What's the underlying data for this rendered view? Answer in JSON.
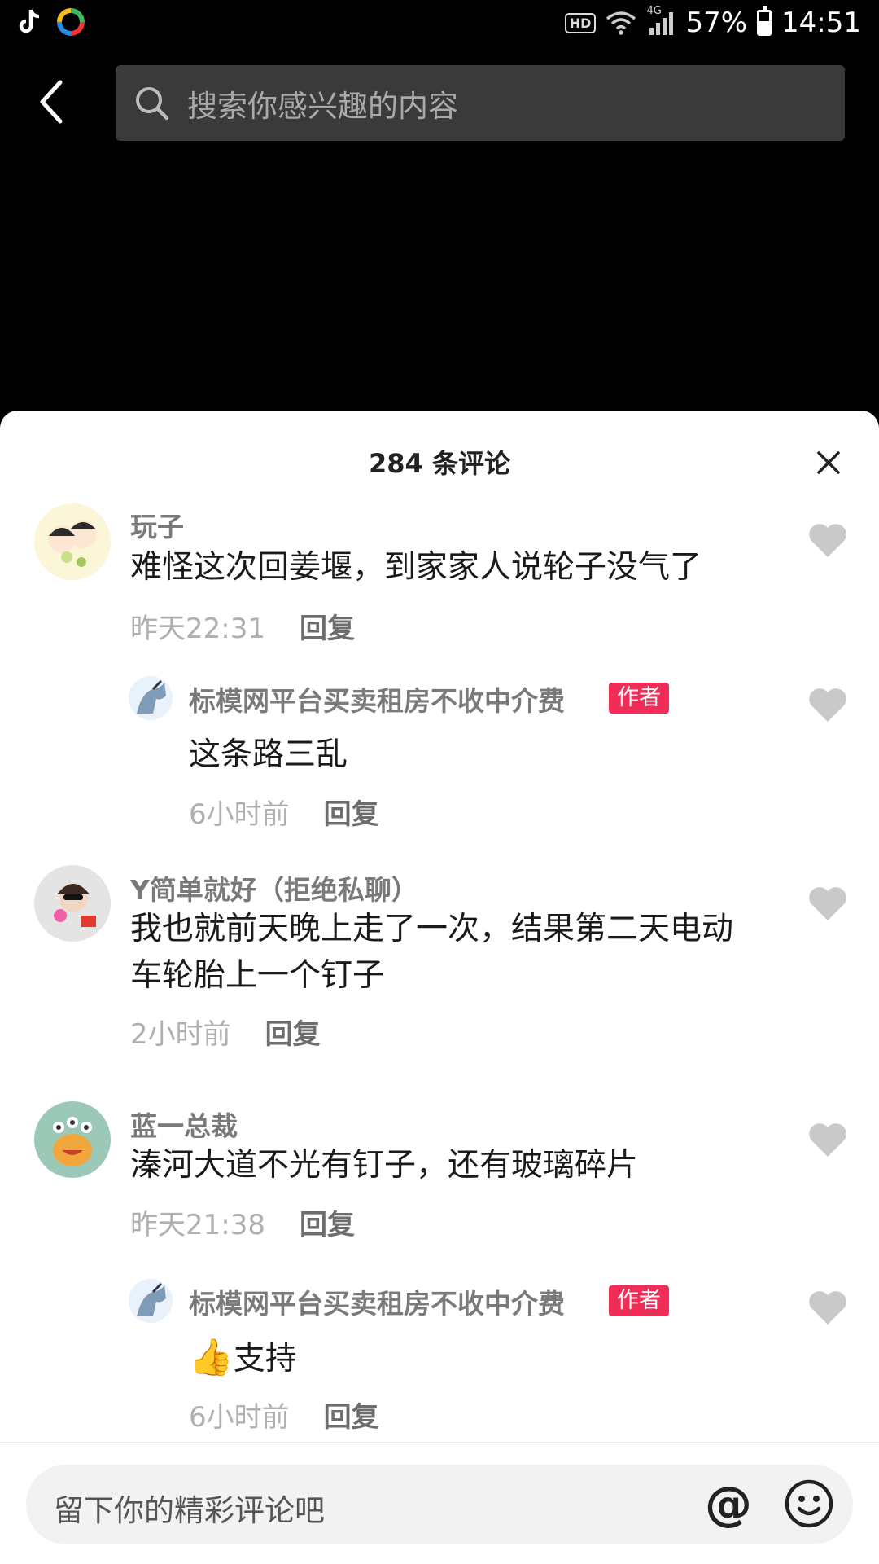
{
  "status_bar": {
    "hd": "HD",
    "network": "4G",
    "battery": "57%",
    "battery_level": 0.57,
    "time": "14:51"
  },
  "search": {
    "placeholder": "搜索你感兴趣的内容"
  },
  "comments_header": {
    "title": "284 条评论"
  },
  "comments": [
    {
      "username": "玩子",
      "text": "难怪这次回姜堰，到家家人说轮子没气了",
      "time": "昨天22:31",
      "reply": "回复",
      "badge": ""
    },
    {
      "username": "标模网平台买卖租房不收中介费",
      "text": "这条路三乱",
      "time": "6小时前",
      "reply": "回复",
      "badge": "作者"
    },
    {
      "username": "Y简单就好（拒绝私聊）",
      "text_line1": "我也就前天晚上走了一次，结果第二天电动",
      "text_line2": "车轮胎上一个钉子",
      "time": "2小时前",
      "reply": "回复",
      "badge": ""
    },
    {
      "username": "蓝一总裁",
      "text": "溱河大道不光有钉子，还有玻璃碎片",
      "time": "昨天21:38",
      "reply": "回复",
      "badge": ""
    },
    {
      "username": "标模网平台买卖租房不收中介费",
      "emoji": "👍",
      "text": "支持",
      "time": "6小时前",
      "reply": "回复",
      "badge": "作者"
    }
  ],
  "input": {
    "placeholder": "留下你的精彩评论吧",
    "at_symbol": "@"
  },
  "colors": {
    "badge": "#ef2d56",
    "heart": "#c9c9c9",
    "background": "#000000",
    "sheet": "#ffffff"
  }
}
